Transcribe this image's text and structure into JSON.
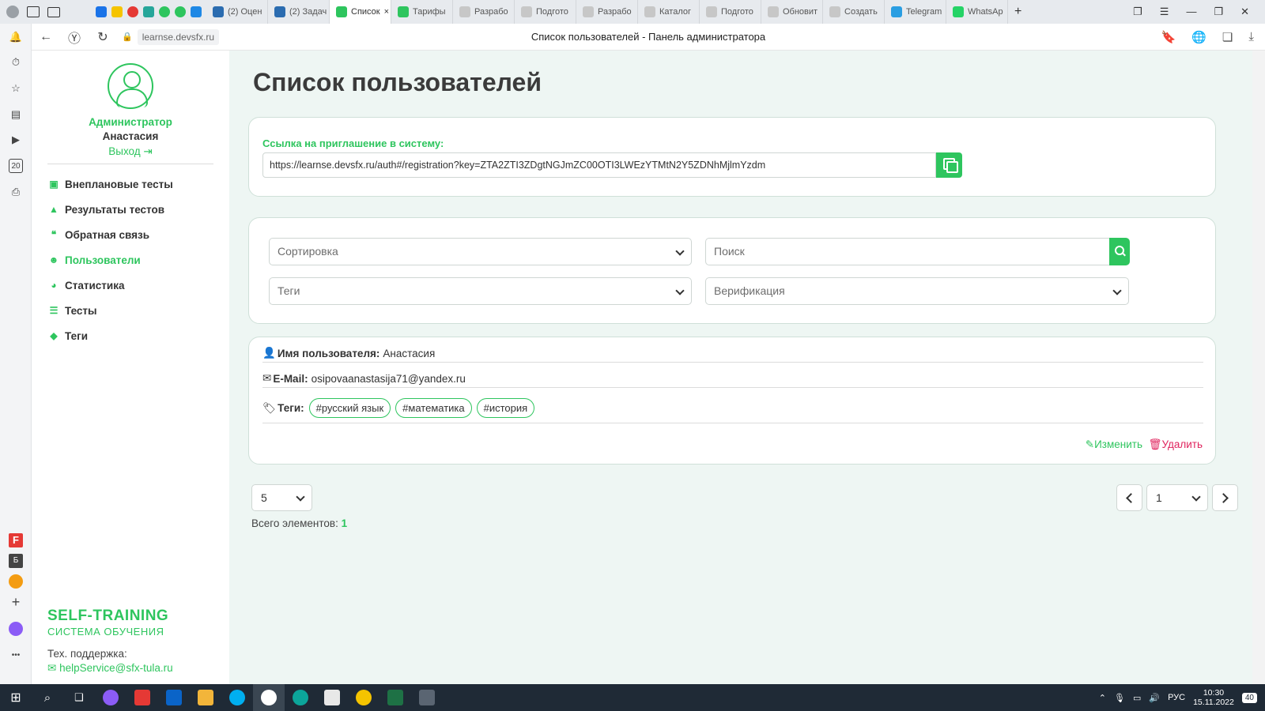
{
  "browser": {
    "tabs": [
      {
        "label": "(2) Оцен",
        "fav": "#2b6cb0"
      },
      {
        "label": "(2) Задач",
        "fav": "#2b6cb0"
      },
      {
        "label": "Список",
        "fav": "#2ec55e",
        "active": true,
        "close": "×"
      },
      {
        "label": "Тарифы",
        "fav": "#2ec55e"
      },
      {
        "label": "Разрабо",
        "fav": "#c7c7c7"
      },
      {
        "label": "Подгото",
        "fav": "#c7c7c7"
      },
      {
        "label": "Разрабо",
        "fav": "#c7c7c7"
      },
      {
        "label": "Каталог",
        "fav": "#c7c7c7"
      },
      {
        "label": "Подгото",
        "fav": "#c7c7c7"
      },
      {
        "label": "Обновит",
        "fav": "#c7c7c7"
      },
      {
        "label": "Создать",
        "fav": "#c7c7c7"
      },
      {
        "label": "Telegram",
        "fav": "#2a9ee2"
      },
      {
        "label": "WhatsAp",
        "fav": "#25d366"
      }
    ],
    "pinned": [
      "24",
      "24"
    ],
    "new_tab": "+",
    "url": "learnse.devsfx.ru",
    "page_title": "Список пользователей - Панель администратора",
    "rail_badge": "20",
    "rail_badge2": "Б",
    "rail_more": "•••",
    "rail_add": "+"
  },
  "sidebar": {
    "role": "Администратор",
    "user_name": "Анастасия",
    "logout": "Выход",
    "menu": [
      {
        "label": "Внеплановые тесты",
        "icon": "calendar-icon"
      },
      {
        "label": "Результаты тестов",
        "icon": "graduation-cap-icon"
      },
      {
        "label": "Обратная связь",
        "icon": "chat-icon"
      },
      {
        "label": "Пользователи",
        "icon": "users-icon",
        "active": true
      },
      {
        "label": "Статистика",
        "icon": "pie-chart-icon"
      },
      {
        "label": "Тесты",
        "icon": "list-icon"
      },
      {
        "label": "Теги",
        "icon": "tag-icon"
      }
    ],
    "brand_main": "SELF-TRAINING",
    "brand_sub": "СИСТЕМА ОБУЧЕНИЯ",
    "support_label": "Тех. поддержка:",
    "support_email": "helpService@sfx-tula.ru"
  },
  "main": {
    "title": "Список пользователей",
    "invite": {
      "label": "Ссылка на приглашение в систему:",
      "link": "https://learnse.devsfx.ru/auth#/registration?key=ZTA2ZTI3ZDgtNGJmZC00OTI3LWEzYTMtN2Y5ZDNhMjlmYzdm"
    },
    "filters": {
      "sort_placeholder": "Сортировка",
      "search_placeholder": "Поиск",
      "tags_placeholder": "Теги",
      "verification_placeholder": "Верификация"
    },
    "user_card": {
      "name_label": "Имя пользователя:",
      "name_value": "Анастасия",
      "email_label": "E-Mail:",
      "email_value": "osipovaanastasija71@yandex.ru",
      "tags_label": "Теги:",
      "tags": [
        "#русский язык",
        "#математика",
        "#история"
      ],
      "edit": "Изменить",
      "delete": "Удалить"
    },
    "pagination": {
      "page_size": "5",
      "page": "1",
      "total_label": "Всего элементов:",
      "total_value": "1"
    }
  },
  "taskbar": {
    "lang": "РУС",
    "time": "10:30",
    "date": "15.11.2022",
    "notifications": "40"
  }
}
